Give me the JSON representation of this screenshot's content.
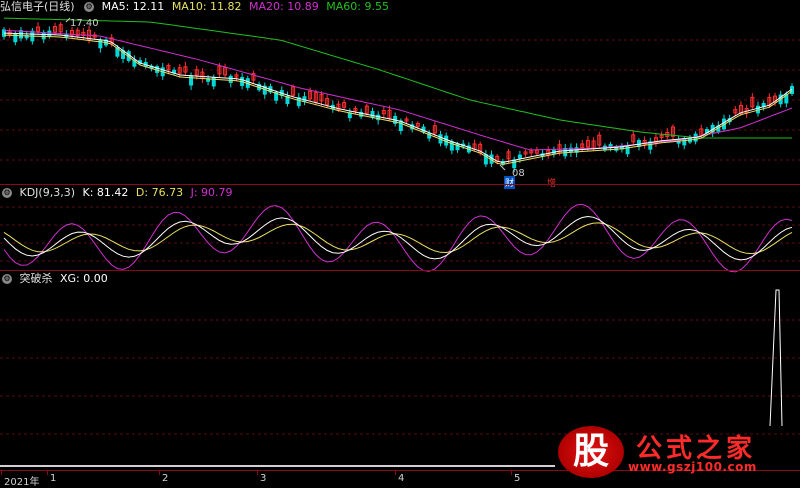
{
  "main": {
    "stock_title": "弘信电子(日线)",
    "ma5_label": "MA5: 12.11",
    "ma10_label": "MA10: 11.82",
    "ma20_label": "MA20: 10.89",
    "ma60_label": "MA60: 9.55",
    "high_price": "17.40",
    "low_price": "08",
    "tag_cai": "财",
    "tag_zeng": "增"
  },
  "kdj": {
    "title": "KDJ(9,3,3)",
    "k_label": "K: 81.42",
    "d_label": "D: 76.73",
    "j_label": "J: 90.79"
  },
  "xg": {
    "title": "突破杀",
    "xg_label": "XG: 0.00"
  },
  "xaxis": {
    "year": "2021年",
    "months": [
      "1",
      "2",
      "3",
      "4",
      "5"
    ]
  },
  "watermark": {
    "big": "股",
    "title": "公式之家",
    "url": "www.gszj100.com"
  },
  "colors": {
    "background": "#000000",
    "up": "#ff3030",
    "down": "#00d8d8",
    "ma5": "#ffffff",
    "ma10": "#e8e060",
    "ma20": "#d030d0",
    "ma60": "#20c020",
    "separator": "#8a0a1a"
  }
}
